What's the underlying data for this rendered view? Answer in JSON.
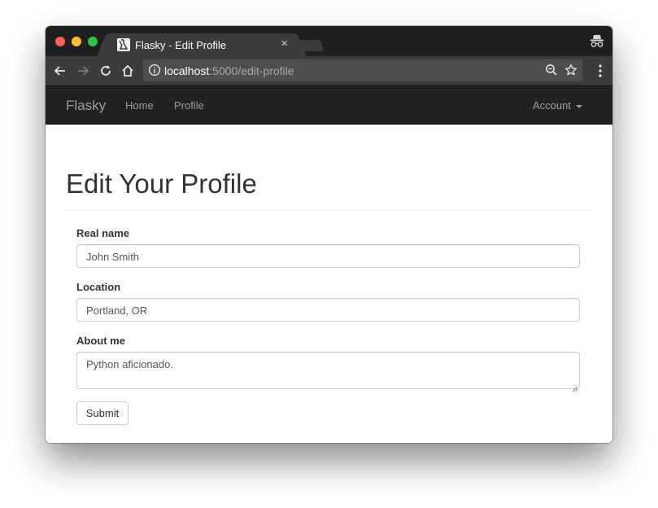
{
  "browser": {
    "tab_title": "Flasky - Edit Profile",
    "tab_close": "×",
    "url_host": "localhost",
    "url_rest": ":5000/edit-profile"
  },
  "navbar": {
    "brand": "Flasky",
    "links": [
      "Home",
      "Profile"
    ],
    "account": "Account"
  },
  "page": {
    "heading": "Edit Your Profile"
  },
  "form": {
    "real_name_label": "Real name",
    "real_name_value": "John Smith",
    "location_label": "Location",
    "location_value": "Portland, OR",
    "about_label": "About me",
    "about_value": "Python aficionado.",
    "submit_label": "Submit"
  },
  "colors": {
    "navbar_bg": "#222222",
    "nav_text": "#9d9d9d",
    "heading_text": "#333333",
    "field_border": "#cccccc"
  },
  "icons": [
    "flask-favicon-icon",
    "close-icon",
    "incognito-icon",
    "back-icon",
    "forward-icon",
    "reload-icon",
    "home-icon",
    "info-icon",
    "zoom-icon",
    "star-icon",
    "menu-dots-icon",
    "caret-down-icon",
    "resize-handle-icon"
  ]
}
